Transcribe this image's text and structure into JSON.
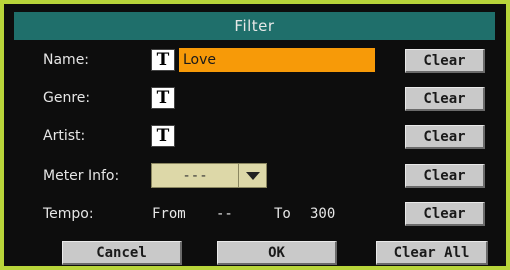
{
  "dialog": {
    "title": "Filter"
  },
  "fields": {
    "name": {
      "label": "Name:",
      "value": "Love",
      "type_icon": "T",
      "clear_label": "Clear"
    },
    "genre": {
      "label": "Genre:",
      "type_icon": "T",
      "clear_label": "Clear"
    },
    "artist": {
      "label": "Artist:",
      "type_icon": "T",
      "clear_label": "Clear"
    },
    "meter": {
      "label": "Meter Info:",
      "value": "---",
      "clear_label": "Clear"
    },
    "tempo": {
      "label": "Tempo:",
      "from_label": "From",
      "from_value": "--",
      "to_label": "To",
      "to_value": "300",
      "clear_label": "Clear"
    }
  },
  "buttons": {
    "cancel": "Cancel",
    "ok": "OK",
    "clear_all": "Clear All"
  },
  "colors": {
    "frame": "#b8d43a",
    "title_bar": "#1f6f6b",
    "name_field": "#f79a08",
    "background": "#0d0d0d"
  }
}
